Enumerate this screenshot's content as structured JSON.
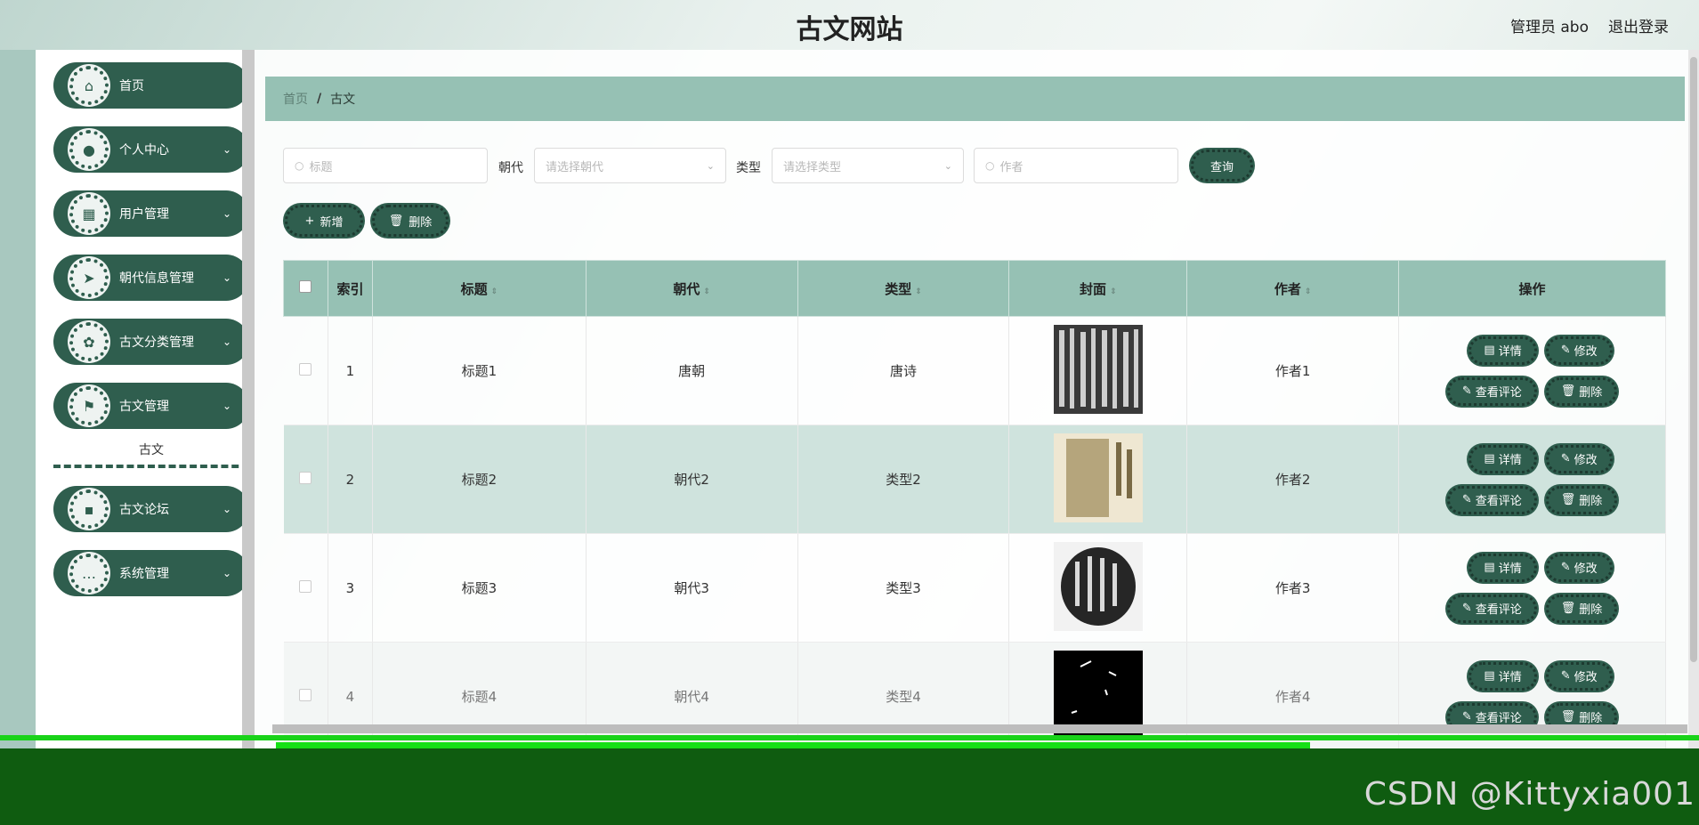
{
  "header": {
    "title": "古文网站",
    "user_label": "管理员 abo",
    "logout_label": "退出登录"
  },
  "sidebar": {
    "items": [
      {
        "label": "首页",
        "icon": "home-icon"
      },
      {
        "label": "个人中心",
        "icon": "user-icon"
      },
      {
        "label": "用户管理",
        "icon": "grid-icon"
      },
      {
        "label": "朝代信息管理",
        "icon": "send-icon"
      },
      {
        "label": "古文分类管理",
        "icon": "bulb-icon"
      },
      {
        "label": "古文管理",
        "icon": "flag-icon"
      },
      {
        "label": "古文论坛",
        "icon": "apps-icon"
      },
      {
        "label": "系统管理",
        "icon": "chat-icon"
      }
    ],
    "active_sub": "古文"
  },
  "breadcrumb": {
    "home": "首页",
    "separator": "/",
    "current": "古文"
  },
  "filters": {
    "title_placeholder": "标题",
    "dynasty_label": "朝代",
    "dynasty_placeholder": "请选择朝代",
    "type_label": "类型",
    "type_placeholder": "请选择类型",
    "author_placeholder": "作者",
    "search_button": "查询"
  },
  "actions": {
    "add": "新增",
    "delete": "删除"
  },
  "table": {
    "headers": {
      "index": "索引",
      "title": "标题",
      "dynasty": "朝代",
      "type": "类型",
      "cover": "封面",
      "author": "作者",
      "ops": "操作"
    },
    "rows": [
      {
        "index": "1",
        "title": "标题1",
        "dynasty": "唐朝",
        "type": "唐诗",
        "author": "作者1"
      },
      {
        "index": "2",
        "title": "标题2",
        "dynasty": "朝代2",
        "type": "类型2",
        "author": "作者2"
      },
      {
        "index": "3",
        "title": "标题3",
        "dynasty": "朝代3",
        "type": "类型3",
        "author": "作者3"
      },
      {
        "index": "4",
        "title": "标题4",
        "dynasty": "朝代4",
        "type": "类型4",
        "author": "作者4"
      }
    ],
    "op_labels": {
      "detail": "详情",
      "edit": "修改",
      "comments": "查看评论",
      "delete": "删除"
    }
  },
  "watermark": "CSDN @Kittyxia001",
  "colors": {
    "primary": "#2f5e4e",
    "header_row": "#96c1b4",
    "highlight_row": "#cfe3dd",
    "footer": "#0f5c10"
  }
}
